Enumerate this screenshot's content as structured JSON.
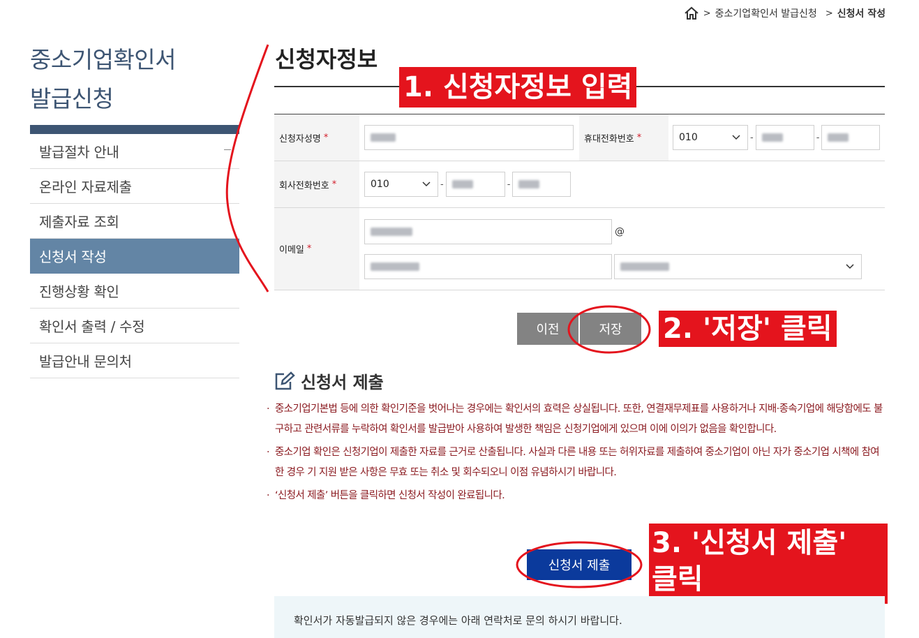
{
  "breadcrumb": {
    "items": [
      "중소기업확인서 발급신청",
      "신청서 작성"
    ]
  },
  "sidebar": {
    "title_line1": "중소기업확인서",
    "title_line2": "발급신청",
    "items": [
      {
        "label": "발급절차 안내"
      },
      {
        "label": "온라인 자료제출"
      },
      {
        "label": "제출자료 조회"
      },
      {
        "label": "신청서 작성"
      },
      {
        "label": "진행상황 확인"
      },
      {
        "label": "확인서 출력 / 수정"
      },
      {
        "label": "발급안내 문의처"
      }
    ]
  },
  "main": {
    "title": "신청자정보",
    "form": {
      "name_label": "신청자성명",
      "mobile_label": "휴대전화번호",
      "mobile_prefix": "010",
      "company_phone_label": "회사전화번호",
      "company_phone_prefix": "010",
      "email_label": "이메일",
      "required_mark": "*",
      "dash": "-",
      "at": "@"
    },
    "buttons": {
      "prev": "이전",
      "save": "저장",
      "submit": "신청서 제출"
    },
    "notice": {
      "title": "신청서 제출",
      "items": [
        "중소기업기본법 등에 의한 확인기준을 벗어나는 경우에는 확인서의 효력은 상실됩니다. 또한, 연결재무제표를 사용하거나 지배·종속기업에 해당함에도 불구하고 관련서류를 누락하여 확인서를 발급받아 사용하여 발생한 책임은 신청기업에게 있으며 이에 이의가 없음을 확인합니다.",
        "중소기업 확인은 신청기업이 제출한 자료를 근거로 산출됩니다. 사실과 다른 내용 또는 허위자료를 제출하여 중소기업이 아닌 자가 중소기업 시책에 참여한 경우 기 지원 받은 사항은 무효 또는 취소 및 회수되오니 이점 유념하시기 바랍니다.",
        "‘신청서 제출’ 버튼을 클릭하면 신청서 작성이 완료됩니다."
      ]
    },
    "info_text": "확인서가 자동발급되지 않은 경우에는 아래 연락처로 문의 하시기 바랍니다."
  },
  "annotations": {
    "step1": "1. 신청자정보 입력",
    "step2": "2. '저장' 클릭",
    "step3_line1": "3. '신청서 제출'",
    "step3_line2": "클릭"
  },
  "colors": {
    "sidebar_accent": "#3d5573",
    "active_item": "#6385a5",
    "submit_button": "#0b3a9c",
    "annotation_red": "#e4141d",
    "notice_text": "#8c1c22"
  },
  "icons": [
    "home-icon",
    "chevron-right-icon",
    "chevron-down-icon",
    "edit-icon"
  ]
}
